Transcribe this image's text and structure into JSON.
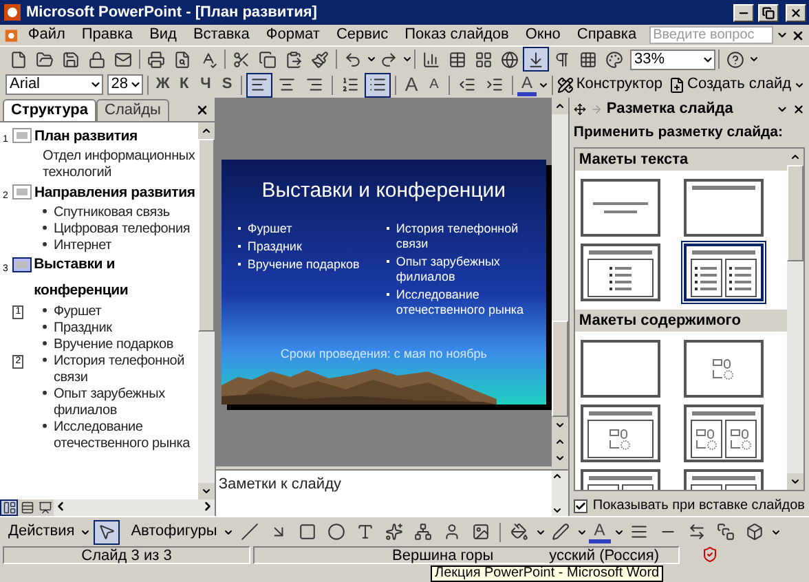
{
  "window": {
    "title": "Microsoft PowerPoint - [План развития]"
  },
  "menu": [
    "Файл",
    "Правка",
    "Вид",
    "Вставка",
    "Формат",
    "Сервис",
    "Показ слайдов",
    "Окно",
    "Справка"
  ],
  "help_search": {
    "placeholder": "Введите вопрос"
  },
  "zoom": {
    "value": "33%"
  },
  "font": {
    "name": "Arial",
    "size": "28"
  },
  "format_buttons": [
    {
      "label": "Ж",
      "pressed": false
    },
    {
      "label": "К",
      "pressed": false
    },
    {
      "label": "Ч",
      "pressed": false
    },
    {
      "label": "S",
      "pressed": false
    }
  ],
  "alignment": [
    {
      "selected": true
    },
    {
      "selected": false
    },
    {
      "selected": false
    }
  ],
  "lists": [
    {
      "pressed": false
    },
    {
      "pressed": true
    }
  ],
  "font_size_buttons": [
    "A",
    "A"
  ],
  "font_color_label": "A",
  "toolbar_buttons": [
    "Конструктор",
    "Создать слайд"
  ],
  "tabs": [
    {
      "label": "Структура",
      "selected": true
    },
    {
      "label": "Слайды",
      "selected": false
    }
  ],
  "outline": [
    {
      "number": "1",
      "title": "План развития",
      "selected": false,
      "items": [
        {
          "kind": "plain",
          "text": "Отдел информационных технологий"
        }
      ]
    },
    {
      "number": "2",
      "title": "Направления развития",
      "selected": false,
      "items": [
        {
          "kind": "bullet",
          "text": "Спутниковая связь"
        },
        {
          "kind": "bullet",
          "text": "Цифровая телефония"
        },
        {
          "kind": "bullet",
          "text": "Интернет"
        }
      ]
    },
    {
      "number": "3",
      "title": "Выставки и конференции",
      "selected": true,
      "items": [
        {
          "kind": "bullet",
          "marker": "1",
          "text": "Фуршет"
        },
        {
          "kind": "bullet",
          "text": "Праздник"
        },
        {
          "kind": "bullet",
          "text": "Вручение подарков"
        },
        {
          "kind": "bullet",
          "marker": "2",
          "text": "История телефонной связи"
        },
        {
          "kind": "bullet",
          "text": "Опыт зарубежных филиалов"
        },
        {
          "kind": "bullet",
          "text": "Исследование отечественного рынка"
        }
      ]
    }
  ],
  "slide": {
    "title": "Выставки и конференции",
    "column_1": [
      "Фуршет",
      "Праздник",
      "Вручение подарков"
    ],
    "column_2": [
      "История телефонной связи",
      "Опыт зарубежных филиалов",
      "Исследование отечественного рынка"
    ],
    "footer": "Сроки проведения: с мая по ноябрь"
  },
  "notes": {
    "placeholder": "Заметки к слайду"
  },
  "task_pane": {
    "title": "Разметка слайда",
    "subtitle": "Применить разметку слайда:",
    "groups": [
      {
        "title": "Макеты текста",
        "layouts": [
          {
            "kind": "title",
            "selected": false
          },
          {
            "kind": "title-only",
            "selected": false
          },
          {
            "kind": "text",
            "selected": false
          },
          {
            "kind": "two-text",
            "selected": true
          }
        ]
      },
      {
        "title": "Макеты содержимого",
        "layouts": [
          {
            "kind": "blank",
            "selected": false
          },
          {
            "kind": "content",
            "selected": false
          },
          {
            "kind": "title-content",
            "selected": false
          },
          {
            "kind": "title-two-content",
            "selected": false
          },
          {
            "kind": "title-four-content",
            "selected": false
          },
          {
            "kind": "title-four-content",
            "selected": false
          }
        ]
      }
    ],
    "show_on_insert": {
      "label": "Показывать при вставке слайдов",
      "checked": true
    }
  },
  "drawing_toolbar": {
    "actions": "Действия",
    "autoshapes": "Автофигуры",
    "font_color_label": "A",
    "pointer_pressed": true
  },
  "status_bar": [
    "Слайд 3 из 3",
    "Вершина горы",
    "усский (Россия)"
  ],
  "tooltip": "Лекция PowerPoint - Microsoft Word"
}
